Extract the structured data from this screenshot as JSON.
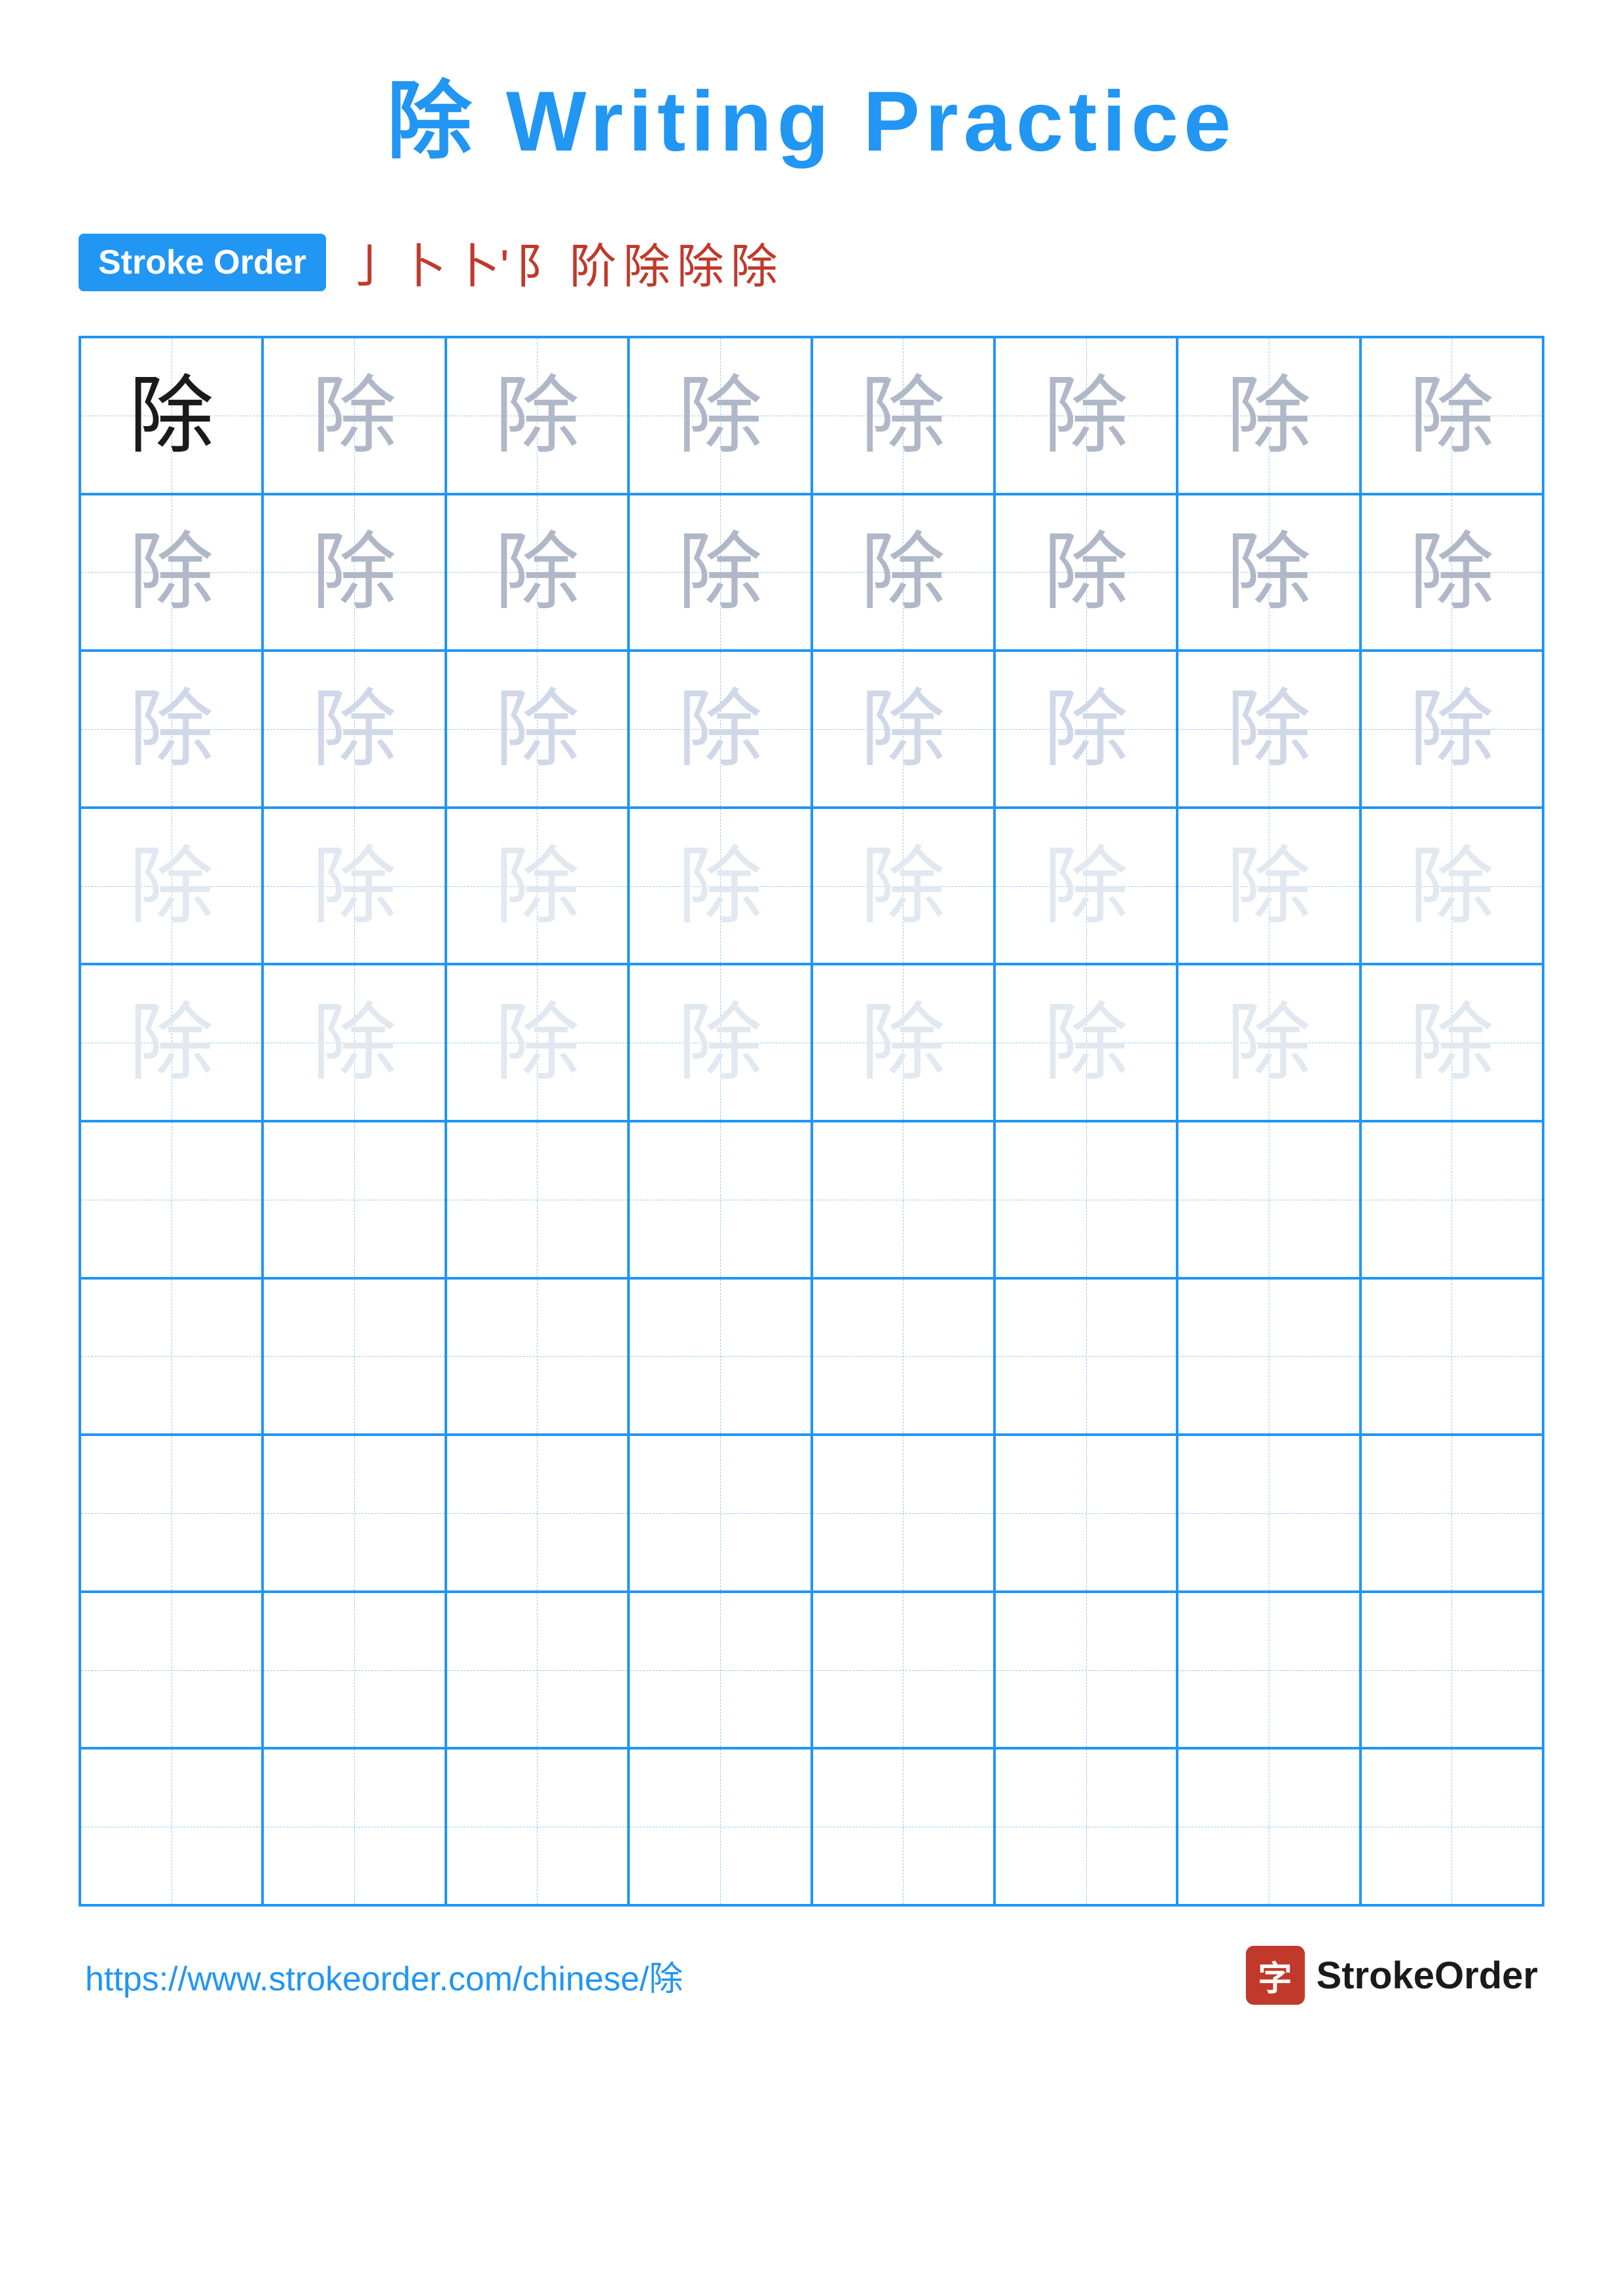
{
  "title": "除 Writing Practice",
  "stroke_order": {
    "badge_label": "Stroke Order",
    "sequence": [
      "亅",
      "卜",
      "卜'",
      "阝",
      "阶",
      "除",
      "除",
      "除"
    ]
  },
  "character": "除",
  "grid": {
    "rows": 10,
    "cols": 8,
    "cells": [
      {
        "row": 0,
        "col": 0,
        "char": "除",
        "style": "dark"
      },
      {
        "row": 0,
        "col": 1,
        "char": "除",
        "style": "medium"
      },
      {
        "row": 0,
        "col": 2,
        "char": "除",
        "style": "medium"
      },
      {
        "row": 0,
        "col": 3,
        "char": "除",
        "style": "medium"
      },
      {
        "row": 0,
        "col": 4,
        "char": "除",
        "style": "medium"
      },
      {
        "row": 0,
        "col": 5,
        "char": "除",
        "style": "medium"
      },
      {
        "row": 0,
        "col": 6,
        "char": "除",
        "style": "medium"
      },
      {
        "row": 0,
        "col": 7,
        "char": "除",
        "style": "medium"
      },
      {
        "row": 1,
        "col": 0,
        "char": "除",
        "style": "medium"
      },
      {
        "row": 1,
        "col": 1,
        "char": "除",
        "style": "medium"
      },
      {
        "row": 1,
        "col": 2,
        "char": "除",
        "style": "medium"
      },
      {
        "row": 1,
        "col": 3,
        "char": "除",
        "style": "medium"
      },
      {
        "row": 1,
        "col": 4,
        "char": "除",
        "style": "medium"
      },
      {
        "row": 1,
        "col": 5,
        "char": "除",
        "style": "medium"
      },
      {
        "row": 1,
        "col": 6,
        "char": "除",
        "style": "medium"
      },
      {
        "row": 1,
        "col": 7,
        "char": "除",
        "style": "medium"
      },
      {
        "row": 2,
        "col": 0,
        "char": "除",
        "style": "light"
      },
      {
        "row": 2,
        "col": 1,
        "char": "除",
        "style": "light"
      },
      {
        "row": 2,
        "col": 2,
        "char": "除",
        "style": "light"
      },
      {
        "row": 2,
        "col": 3,
        "char": "除",
        "style": "light"
      },
      {
        "row": 2,
        "col": 4,
        "char": "除",
        "style": "light"
      },
      {
        "row": 2,
        "col": 5,
        "char": "除",
        "style": "light"
      },
      {
        "row": 2,
        "col": 6,
        "char": "除",
        "style": "light"
      },
      {
        "row": 2,
        "col": 7,
        "char": "除",
        "style": "light"
      },
      {
        "row": 3,
        "col": 0,
        "char": "除",
        "style": "very-light"
      },
      {
        "row": 3,
        "col": 1,
        "char": "除",
        "style": "very-light"
      },
      {
        "row": 3,
        "col": 2,
        "char": "除",
        "style": "very-light"
      },
      {
        "row": 3,
        "col": 3,
        "char": "除",
        "style": "very-light"
      },
      {
        "row": 3,
        "col": 4,
        "char": "除",
        "style": "very-light"
      },
      {
        "row": 3,
        "col": 5,
        "char": "除",
        "style": "very-light"
      },
      {
        "row": 3,
        "col": 6,
        "char": "除",
        "style": "very-light"
      },
      {
        "row": 3,
        "col": 7,
        "char": "除",
        "style": "very-light"
      },
      {
        "row": 4,
        "col": 0,
        "char": "除",
        "style": "very-light"
      },
      {
        "row": 4,
        "col": 1,
        "char": "除",
        "style": "very-light"
      },
      {
        "row": 4,
        "col": 2,
        "char": "除",
        "style": "very-light"
      },
      {
        "row": 4,
        "col": 3,
        "char": "除",
        "style": "very-light"
      },
      {
        "row": 4,
        "col": 4,
        "char": "除",
        "style": "very-light"
      },
      {
        "row": 4,
        "col": 5,
        "char": "除",
        "style": "very-light"
      },
      {
        "row": 4,
        "col": 6,
        "char": "除",
        "style": "very-light"
      },
      {
        "row": 4,
        "col": 7,
        "char": "除",
        "style": "very-light"
      }
    ]
  },
  "footer": {
    "url": "https://www.strokeorder.com/chinese/除",
    "logo_icon": "字",
    "logo_text": "StrokeOrder"
  }
}
